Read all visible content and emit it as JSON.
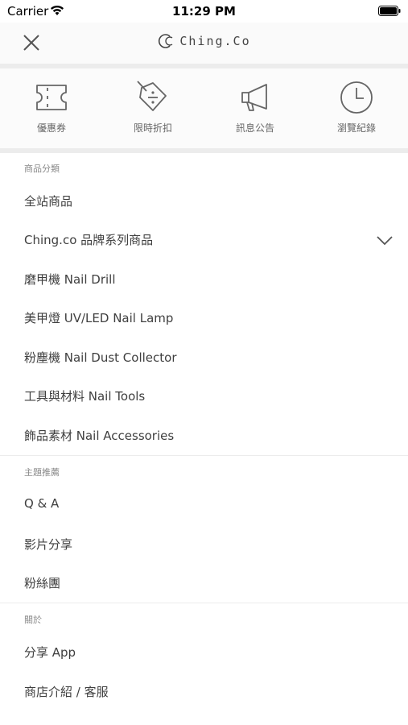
{
  "status_bar": {
    "carrier": "Carrier",
    "time": "11:29 PM"
  },
  "header": {
    "brand": "Ching.Co"
  },
  "quick_links": [
    {
      "label": "優惠券",
      "icon": "ticket-icon"
    },
    {
      "label": "限時折扣",
      "icon": "discount-tag-icon"
    },
    {
      "label": "訊息公告",
      "icon": "megaphone-icon"
    },
    {
      "label": "瀏覽紀錄",
      "icon": "clock-icon"
    }
  ],
  "sections": {
    "categories": {
      "title": "商品分類",
      "items": [
        "全站商品",
        "Ching.co 品牌系列商品",
        "磨甲機 Nail Drill",
        "美甲燈 UV/LED Nail Lamp",
        "粉塵機 Nail Dust Collector",
        "工具與材料 Nail Tools",
        "飾品素材 Nail Accessories"
      ]
    },
    "topics": {
      "title": "主題推薦",
      "items": [
        "Q & A",
        "影片分享",
        "粉絲團"
      ]
    },
    "about": {
      "title": "關於",
      "items": [
        "分享 App",
        "商店介紹 / 客服"
      ]
    }
  }
}
